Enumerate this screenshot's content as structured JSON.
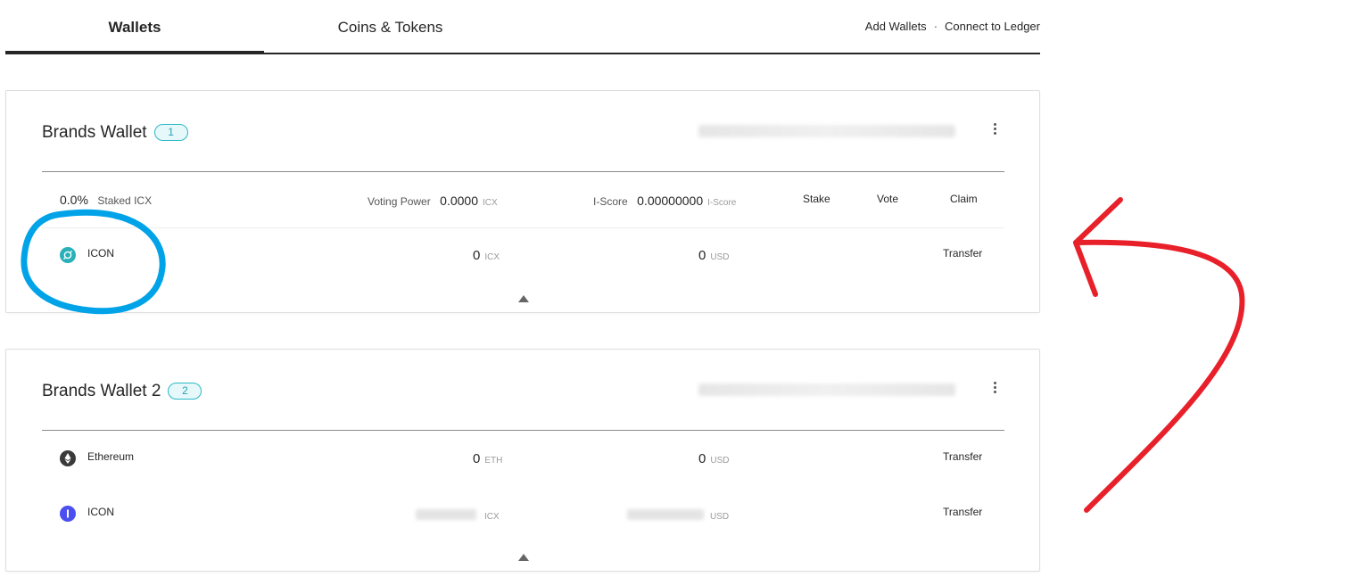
{
  "tabs": [
    {
      "label": "Wallets",
      "active": true
    },
    {
      "label": "Coins & Tokens",
      "active": false
    }
  ],
  "top_links": {
    "add": "Add Wallets",
    "separator": "·",
    "ledger": "Connect to Ledger"
  },
  "wallets": [
    {
      "name": "Brands Wallet",
      "badge": "1",
      "stake_row": {
        "staked_pct": "0.0%",
        "staked_label": "Staked ICX",
        "voting_label": "Voting Power",
        "voting_value": "0.0000",
        "voting_unit": "ICX",
        "iscore_label": "I-Score",
        "iscore_value": "0.00000000",
        "iscore_unit": "I-Score",
        "stake": "Stake",
        "vote": "Vote",
        "claim": "Claim"
      },
      "coins": [
        {
          "name": "ICON",
          "amount": "0",
          "unit": "ICX",
          "usd": "0",
          "usd_unit": "USD",
          "action": "Transfer",
          "icon": "icon-coin-icon"
        }
      ]
    },
    {
      "name": "Brands Wallet 2",
      "badge": "2",
      "coins": [
        {
          "name": "Ethereum",
          "amount": "0",
          "unit": "ETH",
          "usd": "0",
          "usd_unit": "USD",
          "action": "Transfer",
          "icon": "ethereum-icon"
        },
        {
          "name": "ICON",
          "unit": "ICX",
          "usd_unit": "USD",
          "action": "Transfer",
          "icon": "icx-icon"
        }
      ]
    }
  ],
  "colors": {
    "accent_teal": "#2ab8c8",
    "icx_blue": "#4b4ff0",
    "annotation_blue": "#00a3e8",
    "annotation_red": "#e8202a"
  }
}
